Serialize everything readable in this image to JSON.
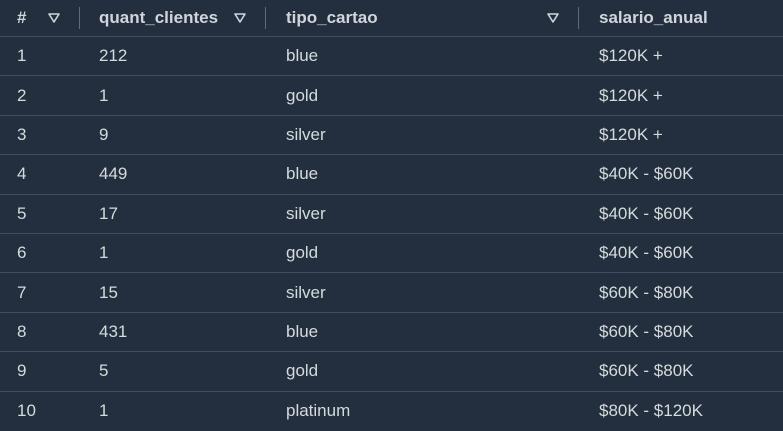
{
  "columns": [
    {
      "label": "#",
      "sortable": true,
      "icon": "filter-triangle-icon"
    },
    {
      "label": "quant_clientes",
      "sortable": true,
      "icon": "filter-triangle-icon"
    },
    {
      "label": "tipo_cartao",
      "sortable": true,
      "icon": "filter-triangle-icon"
    },
    {
      "label": "salario_anual",
      "sortable": false
    }
  ],
  "rows": [
    [
      "1",
      "212",
      "blue",
      "$120K +"
    ],
    [
      "2",
      "1",
      "gold",
      "$120K +"
    ],
    [
      "3",
      "9",
      "silver",
      "$120K +"
    ],
    [
      "4",
      "449",
      "blue",
      "$40K - $60K"
    ],
    [
      "5",
      "17",
      "silver",
      "$40K - $60K"
    ],
    [
      "6",
      "1",
      "gold",
      "$40K - $60K"
    ],
    [
      "7",
      "15",
      "silver",
      "$60K - $80K"
    ],
    [
      "8",
      "431",
      "blue",
      "$60K - $80K"
    ],
    [
      "9",
      "5",
      "gold",
      "$60K - $80K"
    ],
    [
      "10",
      "1",
      "platinum",
      "$80K - $120K"
    ]
  ],
  "colors": {
    "background": "#232f3e",
    "text": "#d5dbdb",
    "divider": "#414d5c"
  }
}
